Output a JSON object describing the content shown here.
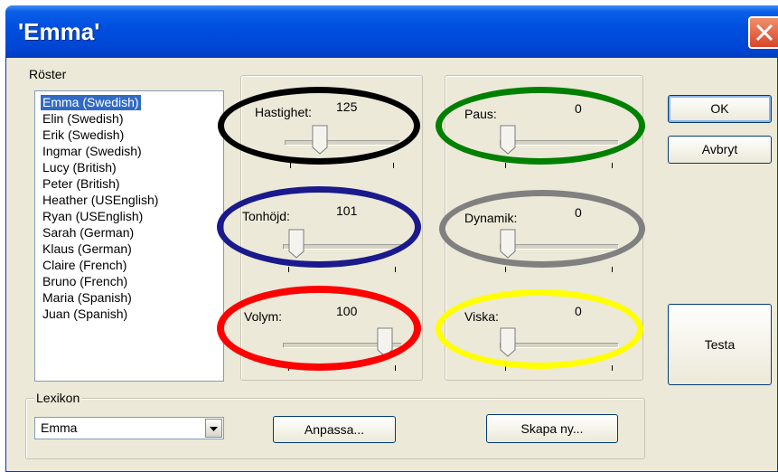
{
  "window": {
    "title": "'Emma'"
  },
  "voices": {
    "label": "Röster",
    "items": [
      "Emma (Swedish)",
      "Elin (Swedish)",
      "Erik (Swedish)",
      "Ingmar (Swedish)",
      "Lucy (British)",
      "Peter (British)",
      "Heather (USEnglish)",
      "Ryan (USEnglish)",
      "Sarah (German)",
      "Klaus (German)",
      "Claire (French)",
      "Bruno (French)",
      "Maria (Spanish)",
      "Juan (Spanish)"
    ],
    "selected_index": 0
  },
  "sliders": {
    "hastighet": {
      "label": "Hastighet:",
      "value": "125",
      "level": 0.28
    },
    "tonhojd": {
      "label": "Tonhöjd:",
      "value": "101",
      "level": 0.05
    },
    "volym": {
      "label": "Volym:",
      "value": "100",
      "level": 0.93
    },
    "paus": {
      "label": "Paus:",
      "value": "0",
      "level": 0.0
    },
    "dynamik": {
      "label": "Dynamik:",
      "value": "0",
      "level": 0.0
    },
    "viska": {
      "label": "Viska:",
      "value": "0",
      "level": 0.0
    }
  },
  "buttons": {
    "ok": "OK",
    "cancel": "Avbryt",
    "test": "Testa",
    "customize": "Anpassa...",
    "create_new": "Skapa ny..."
  },
  "lexicon": {
    "label": "Lexikon",
    "value": "Emma"
  },
  "annotations": {
    "colors": [
      "#000000",
      "#008000",
      "#1a1a8c",
      "#808080",
      "#ff0000",
      "#ffff00"
    ]
  }
}
